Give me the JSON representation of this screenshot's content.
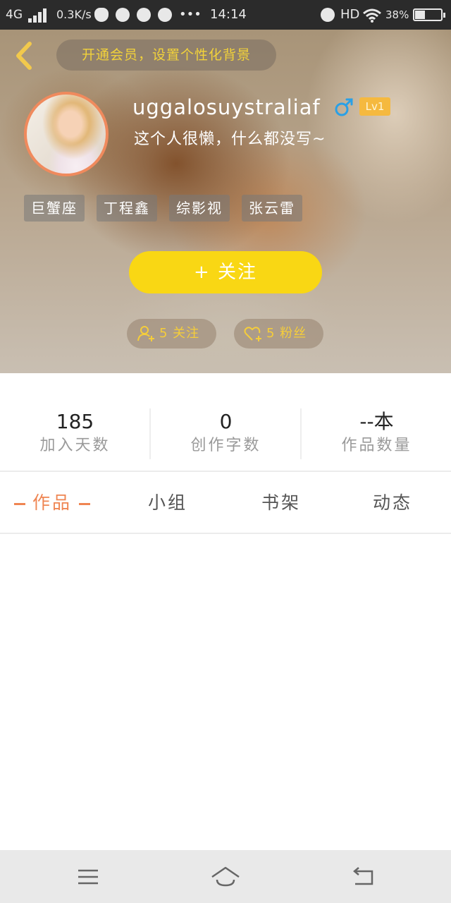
{
  "status_bar": {
    "network": "4G",
    "speed": "0.3K/s",
    "dots": "•••",
    "time": "14:14",
    "hd": "HD",
    "battery": "38%",
    "battery_level": 0.38,
    "icons": [
      "signal-icon",
      "qq-icon",
      "app-icon",
      "app-icon-2",
      "paint-icon",
      "alarm-icon",
      "wifi-icon",
      "battery-icon"
    ]
  },
  "header": {
    "vip_banner": "开通会员，设置个性化背景",
    "username": "uggalosuystraliaf",
    "gender_symbol": "♂",
    "level": "Lv1",
    "bio": "这个人很懒，什么都没写~",
    "tags": [
      "巨蟹座",
      "丁程鑫",
      "综影视",
      "张云雷"
    ],
    "follow_button": "+   关注",
    "following": "5 关注",
    "followers": "5 粉丝"
  },
  "stats": [
    {
      "value": "185",
      "label": "加入天数"
    },
    {
      "value": "0",
      "label": "创作字数"
    },
    {
      "value": "--本",
      "label": "作品数量"
    }
  ],
  "tabs": {
    "active": "作品",
    "items": [
      "作品",
      "小组",
      "书架",
      "动态"
    ]
  },
  "colors": {
    "accent": "#ef8552",
    "follow_button": "#f9d714",
    "vip_text": "#f2d23a",
    "level_badge": "#f5b93f",
    "avatar_border": "#f08a5d"
  }
}
